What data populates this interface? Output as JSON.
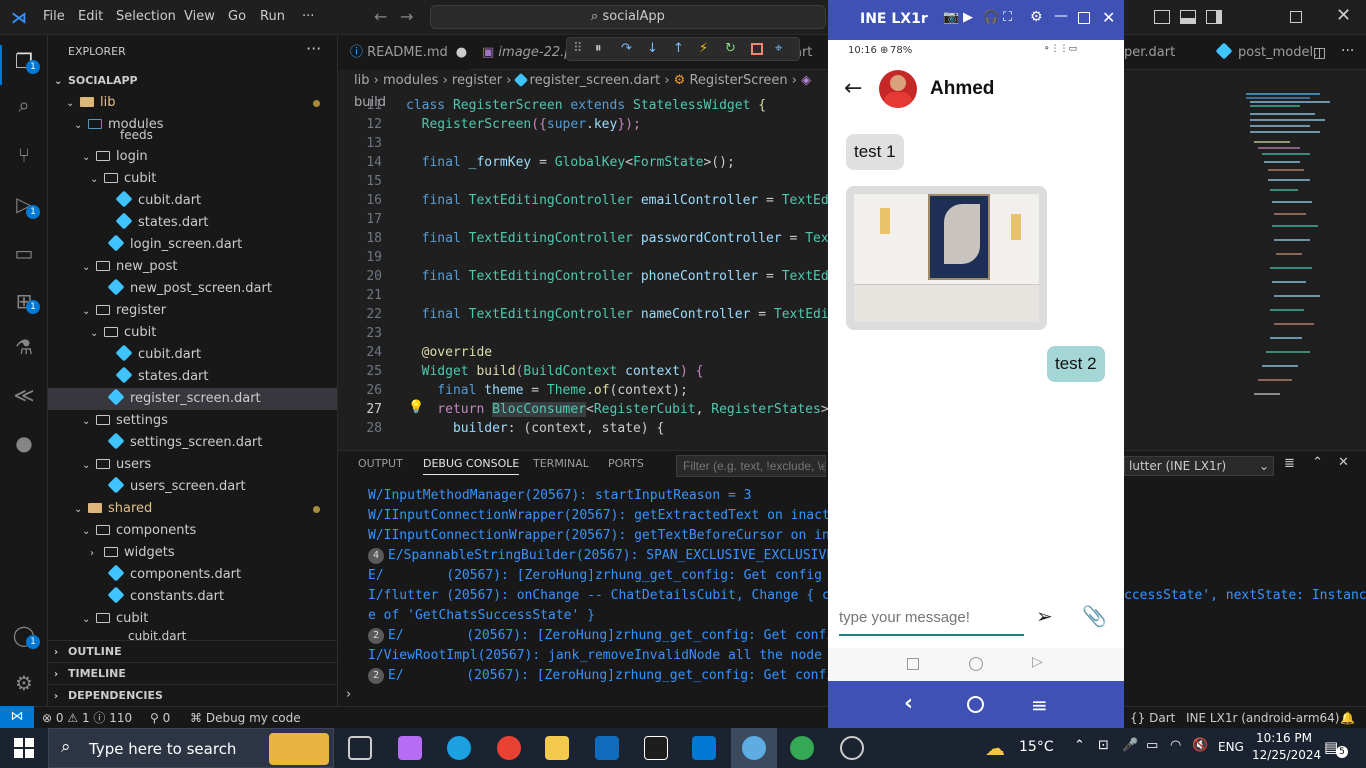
{
  "titlebar": {
    "menus": [
      "File",
      "Edit",
      "Selection",
      "View",
      "Go",
      "Run",
      "···"
    ],
    "search": "socialApp"
  },
  "activity": {
    "badges": [
      "1",
      "1",
      "1",
      "1"
    ]
  },
  "explorer": {
    "title": "EXPLORER",
    "project": "SOCIALAPP",
    "items": [
      {
        "label": "lib",
        "type": "folder"
      },
      {
        "label": "modules",
        "type": "folder"
      },
      {
        "label": "feeds",
        "type": "folder"
      },
      {
        "label": "login",
        "type": "folder"
      },
      {
        "label": "cubit",
        "type": "folder"
      },
      {
        "label": "cubit.dart",
        "type": "dart"
      },
      {
        "label": "states.dart",
        "type": "dart"
      },
      {
        "label": "login_screen.dart",
        "type": "dart"
      },
      {
        "label": "new_post",
        "type": "folder"
      },
      {
        "label": "new_post_screen.dart",
        "type": "dart"
      },
      {
        "label": "register",
        "type": "folder"
      },
      {
        "label": "cubit",
        "type": "folder"
      },
      {
        "label": "cubit.dart",
        "type": "dart"
      },
      {
        "label": "states.dart",
        "type": "dart"
      },
      {
        "label": "register_screen.dart",
        "type": "dart"
      },
      {
        "label": "settings",
        "type": "folder"
      },
      {
        "label": "settings_screen.dart",
        "type": "dart"
      },
      {
        "label": "users",
        "type": "folder"
      },
      {
        "label": "users_screen.dart",
        "type": "dart"
      },
      {
        "label": "shared",
        "type": "folder"
      },
      {
        "label": "components",
        "type": "folder"
      },
      {
        "label": "widgets",
        "type": "folder"
      },
      {
        "label": "components.dart",
        "type": "dart"
      },
      {
        "label": "constants.dart",
        "type": "dart"
      },
      {
        "label": "cubit",
        "type": "folder"
      },
      {
        "label": "cubit.dart",
        "type": "dart"
      }
    ],
    "sections": [
      "OUTLINE",
      "TIMELINE",
      "DEPENDENCIES"
    ]
  },
  "tabs": {
    "readme": "README.md",
    "image": "image-22.p",
    "art": "art",
    "super": "per.dart",
    "post_model": "post_model."
  },
  "breadcrumb": {
    "lib": "lib",
    "modules": "modules",
    "register": "register",
    "file": "register_screen.dart",
    "class": "RegisterScreen",
    "method": "build"
  },
  "code": {
    "l11_n": "11",
    "l11_a": "class ",
    "l11_b": "RegisterScreen",
    "l11_c": " extends ",
    "l11_d": "StatelessWidget",
    "l11_e": " {",
    "l12_n": "12",
    "l12_a": "  RegisterScreen",
    "l12_b": "({",
    "l12_c": "super",
    "l12_d": ".",
    "l12_e": "key",
    "l12_f": "});",
    "l13_n": "13",
    "l14_n": "14",
    "l14_a": "  final ",
    "l14_b": "_formKey",
    "l14_c": " = ",
    "l14_d": "GlobalKey",
    "l14_e": "<",
    "l14_f": "FormState",
    "l14_g": ">();",
    "l15_n": "15",
    "l16_n": "16",
    "l16_a": "  final ",
    "l16_b": "TextEditingController",
    "l16_c": " emailController",
    "l16_d": " = ",
    "l16_e": "TextEdi",
    "l17_n": "17",
    "l18_n": "18",
    "l18_a": "  final ",
    "l18_b": "TextEditingController",
    "l18_c": " passwordController",
    "l18_d": " = ",
    "l18_e": "Text",
    "l19_n": "19",
    "l20_n": "20",
    "l20_a": "  final ",
    "l20_b": "TextEditingController",
    "l20_c": " phoneController",
    "l20_d": " = ",
    "l20_e": "TextEdi",
    "l21_n": "21",
    "l22_n": "22",
    "l22_a": "  final ",
    "l22_b": "TextEditingController",
    "l22_c": " nameController",
    "l22_d": " = ",
    "l22_e": "TextEdit",
    "l23_n": "23",
    "l24_n": "24",
    "l24_a": "  @override",
    "l25_n": "25",
    "l25_a": "  Widget ",
    "l25_b": "build",
    "l25_c": "(",
    "l25_d": "BuildContext",
    "l25_e": " context",
    ") {": "",
    "l25_f": ") {",
    "l26_n": "26",
    "l26_a": "    final ",
    "l26_b": "theme",
    "l26_c": " = ",
    "l26_d": "Theme",
    "l26_e": ".",
    "l26_f": "of",
    "l26_g": "(context);",
    "l27_n": "27",
    "l27_a": "    return ",
    "l27_b": "BlocConsumer",
    "l27_c": "<",
    "l27_d": "RegisterCubit",
    "l27_e": ", ",
    "l27_f": "RegisterStates",
    "l27_g": ">(",
    "l28_n": "28",
    "l28_a": "      builder",
    "l28_b": ": (context, state) {"
  },
  "panel": {
    "tabs": [
      "OUTPUT",
      "DEBUG CONSOLE",
      "TERMINAL",
      "PORTS"
    ],
    "filter_placeholder": "Filter (e.g. text, !exclude, \\es",
    "device": "lutter (INE LX1r)",
    "logs": [
      {
        "count": "",
        "text": "W/InputMethodManager(20567): startInputReason = 3"
      },
      {
        "count": "",
        "text": "W/IInputConnectionWrapper(20567): getExtractedText on inacti"
      },
      {
        "count": "",
        "text": "W/IInputConnectionWrapper(20567): getTextBeforeCursor on ina"
      },
      {
        "count": "4",
        "text": "E/SpannableStringBuilder(20567): SPAN_EXCLUSIVE_EXCLUSIVE"
      },
      {
        "count": "",
        "text": "E/        (20567): [ZeroHung]zrhung_get_config: Get config f"
      },
      {
        "count": "",
        "text": "I/flutter (20567): onChange -- ChatDetailsCubit, Change { cu"
      },
      {
        "count": "",
        "text": "e of 'GetChatsSuccessState' }"
      },
      {
        "count": "2",
        "text": "E/        (20567): [ZeroHung]zrhung_get_config: Get confi"
      },
      {
        "count": "",
        "text": "I/ViewRootImpl(20567): jank_removeInvalidNode all the node i"
      },
      {
        "count": "2",
        "text": "E/        (20567): [ZeroHung]zrhung_get_config: Get confi"
      }
    ],
    "log_right": "ccessState', nextState: Instanc"
  },
  "statusbar": {
    "errors": "0",
    "warnings": "1",
    "info": "110",
    "ports": "0",
    "debug": "Debug my code",
    "language": "Dart",
    "device": "INE LX1r (android-arm64)"
  },
  "phone": {
    "window_title": "INE LX1r",
    "status_time": "10:16",
    "battery": "78%",
    "contact": "Ahmed",
    "messages": [
      {
        "text": "test 1",
        "from": "other"
      },
      {
        "text": "test 2",
        "from": "me"
      }
    ],
    "input_placeholder": "type your message!"
  },
  "taskbar": {
    "search": "Type here to search",
    "temperature": "15°C",
    "lang": "ENG",
    "time": "10:16 PM",
    "date": "12/25/2024",
    "notifications": "5"
  },
  "colors": {
    "accent": "#0078d4",
    "phone_bar": "#3f51b5",
    "my_bubble": "#a5d6d6",
    "other_bubble": "#e0e0e0",
    "input_underline": "#1e7f7f"
  }
}
